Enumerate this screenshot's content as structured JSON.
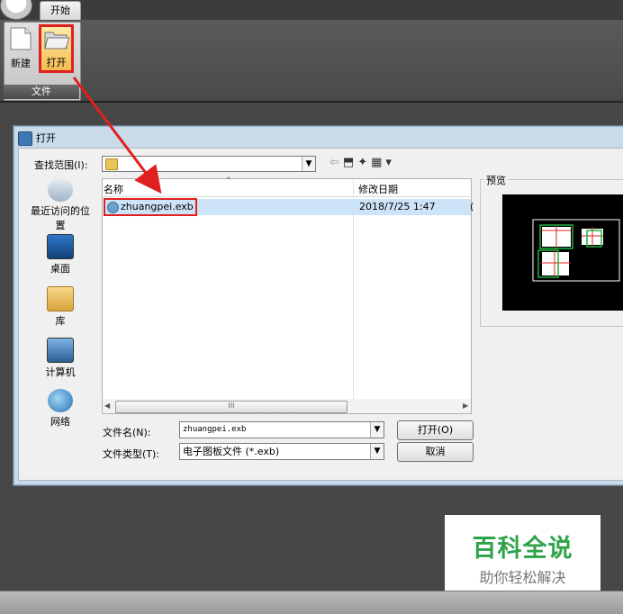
{
  "ribbon": {
    "tab_start": "开始",
    "btn_new": "新建",
    "btn_open": "打开",
    "group_file": "文件"
  },
  "dialog": {
    "title": "打开",
    "lookin_label": "查找范围(I):",
    "places": [
      "最近访问的位置",
      "桌面",
      "库",
      "计算机",
      "网络"
    ],
    "columns": {
      "name": "名称",
      "date": "修改日期"
    },
    "file": {
      "name": "zhuangpei.exb",
      "date": "2018/7/25 1:47",
      "extra": "("
    },
    "scroll_grip": "III",
    "filename_label": "文件名(N):",
    "filename_value": "zhuangpei.exb",
    "filetype_label": "文件类型(T):",
    "filetype_value": "电子图板文件 (*.exb)",
    "open_button": "打开(O)",
    "cancel_button": "取消",
    "preview_label": "预览"
  },
  "watermark": {
    "title": "百科全说",
    "subtitle": "助你轻松解决"
  },
  "colors": {
    "highlight": "#e02020",
    "brand_green": "#2fa34a",
    "selection": "#cde3f7"
  },
  "icons": [
    "app-logo-icon",
    "new-doc-icon",
    "open-folder-icon",
    "folder-icon",
    "back-icon",
    "up-folder-icon",
    "new-folder-icon",
    "view-menu-icon",
    "file-icon"
  ]
}
